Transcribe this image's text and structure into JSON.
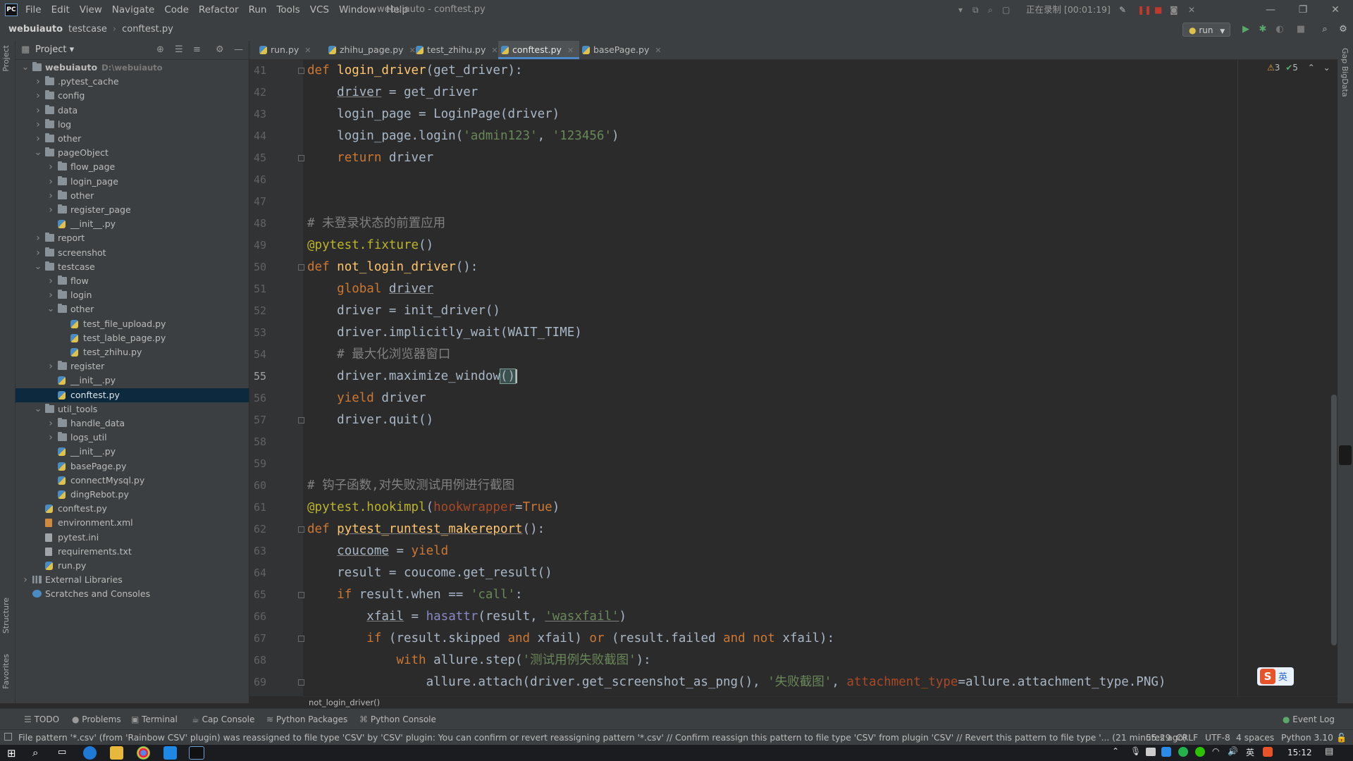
{
  "menubar": {
    "items": [
      "File",
      "Edit",
      "View",
      "Navigate",
      "Code",
      "Refactor",
      "Run",
      "Tools",
      "VCS",
      "Window",
      "Help"
    ],
    "window_title": "webuiauto - conftest.py",
    "record_status": "正在录制 [00:01:19]"
  },
  "navbar": {
    "breadcrumb": [
      "webuiauto",
      "testcase",
      "conftest.py"
    ],
    "run_config": "run"
  },
  "left_strip": {
    "project_label": "Project",
    "structure_label": "Structure",
    "favorites_label": "Favorites"
  },
  "right_strip": {
    "label": "Gap BigData"
  },
  "project_panel": {
    "title": "Project",
    "tree": [
      {
        "label": "webuiauto",
        "path": "D:\\webuiauto",
        "depth": 0,
        "type": "folder",
        "expanded": true,
        "bold": true
      },
      {
        "label": ".pytest_cache",
        "depth": 1,
        "type": "folder",
        "expanded": false
      },
      {
        "label": "config",
        "depth": 1,
        "type": "folder",
        "expanded": false
      },
      {
        "label": "data",
        "depth": 1,
        "type": "folder",
        "expanded": false
      },
      {
        "label": "log",
        "depth": 1,
        "type": "folder",
        "expanded": false
      },
      {
        "label": "other",
        "depth": 1,
        "type": "folder",
        "expanded": false
      },
      {
        "label": "pageObject",
        "depth": 1,
        "type": "folder",
        "expanded": true
      },
      {
        "label": "flow_page",
        "depth": 2,
        "type": "folder",
        "expanded": false
      },
      {
        "label": "login_page",
        "depth": 2,
        "type": "folder",
        "expanded": false
      },
      {
        "label": "other",
        "depth": 2,
        "type": "folder",
        "expanded": false
      },
      {
        "label": "register_page",
        "depth": 2,
        "type": "folder",
        "expanded": false
      },
      {
        "label": "__init__.py",
        "depth": 2,
        "type": "py"
      },
      {
        "label": "report",
        "depth": 1,
        "type": "folder",
        "expanded": false
      },
      {
        "label": "screenshot",
        "depth": 1,
        "type": "folder",
        "expanded": false
      },
      {
        "label": "testcase",
        "depth": 1,
        "type": "folder",
        "expanded": true
      },
      {
        "label": "flow",
        "depth": 2,
        "type": "folder",
        "expanded": false
      },
      {
        "label": "login",
        "depth": 2,
        "type": "folder",
        "expanded": false
      },
      {
        "label": "other",
        "depth": 2,
        "type": "folder",
        "expanded": true
      },
      {
        "label": "test_file_upload.py",
        "depth": 3,
        "type": "py"
      },
      {
        "label": "test_lable_page.py",
        "depth": 3,
        "type": "py"
      },
      {
        "label": "test_zhihu.py",
        "depth": 3,
        "type": "py"
      },
      {
        "label": "register",
        "depth": 2,
        "type": "folder",
        "expanded": false
      },
      {
        "label": "__init__.py",
        "depth": 2,
        "type": "py"
      },
      {
        "label": "conftest.py",
        "depth": 2,
        "type": "py",
        "selected": true
      },
      {
        "label": "util_tools",
        "depth": 1,
        "type": "folder",
        "expanded": true
      },
      {
        "label": "handle_data",
        "depth": 2,
        "type": "folder",
        "expanded": false
      },
      {
        "label": "logs_util",
        "depth": 2,
        "type": "folder",
        "expanded": false
      },
      {
        "label": "__init__.py",
        "depth": 2,
        "type": "py"
      },
      {
        "label": "basePage.py",
        "depth": 2,
        "type": "py"
      },
      {
        "label": "connectMysql.py",
        "depth": 2,
        "type": "py"
      },
      {
        "label": "dingRebot.py",
        "depth": 2,
        "type": "py"
      },
      {
        "label": "conftest.py",
        "depth": 1,
        "type": "py"
      },
      {
        "label": "environment.xml",
        "depth": 1,
        "type": "xml"
      },
      {
        "label": "pytest.ini",
        "depth": 1,
        "type": "txt"
      },
      {
        "label": "requirements.txt",
        "depth": 1,
        "type": "txt"
      },
      {
        "label": "run.py",
        "depth": 1,
        "type": "py"
      },
      {
        "label": "External Libraries",
        "depth": 0,
        "type": "libs",
        "expanded": false
      },
      {
        "label": "Scratches and Consoles",
        "depth": 0,
        "type": "scratch"
      }
    ]
  },
  "tabs": [
    {
      "label": "run.py",
      "active": false
    },
    {
      "label": "zhihu_page.py",
      "active": false
    },
    {
      "label": "test_zhihu.py",
      "active": false
    },
    {
      "label": "conftest.py",
      "active": true
    },
    {
      "label": "basePage.py",
      "active": false
    }
  ],
  "inspection": {
    "warnings": "3",
    "ok": "5"
  },
  "editor": {
    "current_line": 55,
    "lines": [
      {
        "n": "41",
        "fold": true,
        "segs": [
          [
            "kw",
            "def "
          ],
          [
            "fn",
            "login_driver"
          ],
          [
            "",
            "(get_driver):"
          ]
        ]
      },
      {
        "n": "42",
        "segs": [
          [
            "",
            "    "
          ],
          [
            "ul",
            "driver"
          ],
          [
            "",
            " = get_driver"
          ]
        ]
      },
      {
        "n": "43",
        "segs": [
          [
            "",
            "    login_page = LoginPage(driver)"
          ]
        ]
      },
      {
        "n": "44",
        "segs": [
          [
            "",
            "    login_page.login("
          ],
          [
            "str",
            "'admin123'"
          ],
          [
            "",
            ", "
          ],
          [
            "str",
            "'123456'"
          ],
          [
            "",
            ")"
          ]
        ]
      },
      {
        "n": "45",
        "fold": true,
        "segs": [
          [
            "",
            "    "
          ],
          [
            "kw",
            "return "
          ],
          [
            "",
            "driver"
          ]
        ]
      },
      {
        "n": "46",
        "segs": []
      },
      {
        "n": "47",
        "segs": []
      },
      {
        "n": "48",
        "segs": [
          [
            "cm",
            "# 未登录状态的前置应用"
          ]
        ]
      },
      {
        "n": "49",
        "segs": [
          [
            "dec",
            "@pytest.fixture"
          ],
          [
            "",
            "()"
          ]
        ]
      },
      {
        "n": "50",
        "fold": true,
        "segs": [
          [
            "kw",
            "def "
          ],
          [
            "fn",
            "not_login_driver"
          ],
          [
            "",
            "():"
          ]
        ]
      },
      {
        "n": "51",
        "segs": [
          [
            "",
            "    "
          ],
          [
            "kw",
            "global "
          ],
          [
            "ul",
            "driver"
          ]
        ]
      },
      {
        "n": "52",
        "segs": [
          [
            "",
            "    driver = init_driver()"
          ]
        ]
      },
      {
        "n": "53",
        "segs": [
          [
            "",
            "    driver.implicitly_wait(WAIT_TIME)"
          ]
        ]
      },
      {
        "n": "54",
        "segs": [
          [
            "",
            "    "
          ],
          [
            "cm",
            "# 最大化浏览器窗口"
          ]
        ]
      },
      {
        "n": "55",
        "segs": [
          [
            "",
            "    driver.maximize_window"
          ],
          [
            "match",
            "()"
          ]
        ]
      },
      {
        "n": "56",
        "segs": [
          [
            "",
            "    "
          ],
          [
            "kw",
            "yield "
          ],
          [
            "",
            "driver"
          ]
        ]
      },
      {
        "n": "57",
        "fold": true,
        "segs": [
          [
            "",
            "    driver.quit()"
          ]
        ]
      },
      {
        "n": "58",
        "segs": []
      },
      {
        "n": "59",
        "segs": []
      },
      {
        "n": "60",
        "segs": [
          [
            "cm",
            "# 钩子函数,对失败测试用例进行截图"
          ]
        ]
      },
      {
        "n": "61",
        "segs": [
          [
            "dec",
            "@pytest.hookimpl"
          ],
          [
            "",
            "("
          ],
          [
            "param",
            "hookwrapper"
          ],
          [
            "",
            "="
          ],
          [
            "kw",
            "True"
          ],
          [
            "",
            ")"
          ]
        ]
      },
      {
        "n": "62",
        "fold": true,
        "segs": [
          [
            "kw",
            "def "
          ],
          [
            "fnul",
            "pytest_runtest_makereport"
          ],
          [
            "",
            "():"
          ]
        ]
      },
      {
        "n": "63",
        "segs": [
          [
            "",
            "    "
          ],
          [
            "ul",
            "coucome"
          ],
          [
            "",
            " = "
          ],
          [
            "kw",
            "yield"
          ]
        ]
      },
      {
        "n": "64",
        "segs": [
          [
            "",
            "    result = coucome.get_result()"
          ]
        ]
      },
      {
        "n": "65",
        "fold": true,
        "segs": [
          [
            "",
            "    "
          ],
          [
            "kw",
            "if "
          ],
          [
            "",
            "result.when == "
          ],
          [
            "str",
            "'call'"
          ],
          [
            "",
            ":"
          ]
        ]
      },
      {
        "n": "66",
        "segs": [
          [
            "",
            "        "
          ],
          [
            "ul",
            "xfail"
          ],
          [
            "",
            " = "
          ],
          [
            "bi",
            "hasattr"
          ],
          [
            "",
            "(result, "
          ],
          [
            "strul",
            "'wasxfail'"
          ],
          [
            "",
            ")"
          ]
        ]
      },
      {
        "n": "67",
        "fold": true,
        "segs": [
          [
            "",
            "        "
          ],
          [
            "kw",
            "if "
          ],
          [
            "",
            "(result.skipped "
          ],
          [
            "kw",
            "and "
          ],
          [
            "",
            "xfail) "
          ],
          [
            "kw",
            "or "
          ],
          [
            "",
            "(result.failed "
          ],
          [
            "kw",
            "and not "
          ],
          [
            "",
            "xfail):"
          ]
        ]
      },
      {
        "n": "68",
        "segs": [
          [
            "",
            "            "
          ],
          [
            "kw",
            "with "
          ],
          [
            "",
            "allure.step("
          ],
          [
            "str",
            "'测试用例失败截图'"
          ],
          [
            "",
            "):"
          ]
        ]
      },
      {
        "n": "69",
        "fold": true,
        "segs": [
          [
            "",
            "                allure.attach(driver.get_screenshot_as_png(), "
          ],
          [
            "str",
            "'失败截图'"
          ],
          [
            "",
            ", "
          ],
          [
            "param",
            "attachment_type"
          ],
          [
            "",
            "=allure.attachment_type.PNG)"
          ]
        ]
      }
    ],
    "footer_breadcrumb": "not_login_driver()"
  },
  "tool_tabs": [
    "TODO",
    "Problems",
    "Terminal",
    "Cap Console",
    "Python Packages",
    "Python Console"
  ],
  "event_log": "Event Log",
  "status": {
    "message": "File pattern '*.csv' (from 'Rainbow CSV' plugin) was reassigned to file type 'CSV' by 'CSV' plugin: You can confirm or revert reassigning pattern '*.csv' // Confirm reassign this pattern to file type 'CSV' from plugin 'CSV' // Revert this pattern to file type '... (21 minutes ago)",
    "position": "55:29",
    "line_sep": "CRLF",
    "encoding": "UTF-8",
    "indent": "4 spaces",
    "interpreter": "Python 3.10"
  },
  "taskbar": {
    "ime": "英",
    "time": "15:12"
  },
  "colors": {
    "accent": "#4a88c7",
    "selection": "#0d293e",
    "keyword": "#cc7832",
    "function": "#ffc66d",
    "string": "#6a8759",
    "comment": "#808080",
    "decorator": "#bbb529"
  }
}
